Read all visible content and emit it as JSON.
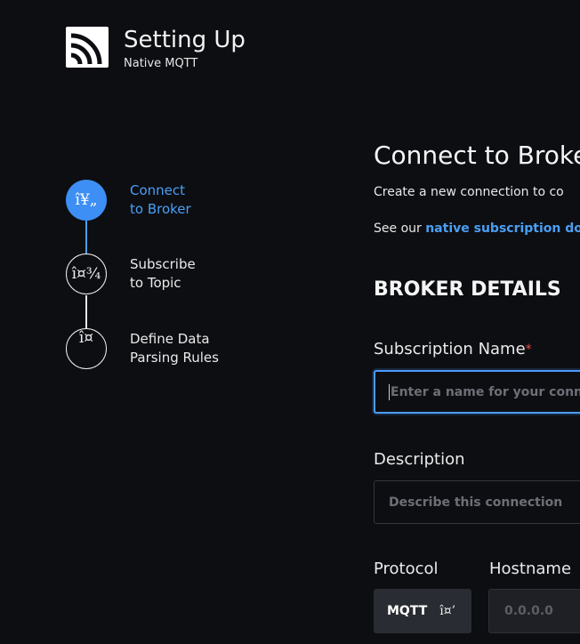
{
  "header": {
    "title": "Setting Up",
    "subtitle": "Native MQTT",
    "logo_icon": "broadcast-signal-logo"
  },
  "steps": [
    {
      "icon_text": "î¥„",
      "label": "Connect\nto Broker",
      "state": "active"
    },
    {
      "icon_text": "î¤¾",
      "label": "Subscribe\nto Topic",
      "state": "pending"
    },
    {
      "icon_text": "î¤",
      "label": "Define Data\nParsing Rules",
      "state": "pending"
    }
  ],
  "main": {
    "title": "Connect to Broke",
    "description": "Create a new connection to co",
    "see_prefix": "See our ",
    "see_link": "native subscription do",
    "section_heading": "BROKER DETAILS"
  },
  "form": {
    "subscription_name": {
      "label": "Subscription Name",
      "required_mark": "*",
      "placeholder": "Enter a name for your conne"
    },
    "description": {
      "label": "Description",
      "placeholder": "Describe this connection"
    },
    "protocol": {
      "label": "Protocol",
      "value": "MQTT",
      "caret_text": "î¤’"
    },
    "hostname": {
      "label": "Hostname",
      "placeholder": "0.0.0.0"
    }
  },
  "colors": {
    "background": "#0d0e12",
    "accent": "#3d8ff5",
    "link": "#4a9ff5",
    "required": "#e0504a"
  }
}
